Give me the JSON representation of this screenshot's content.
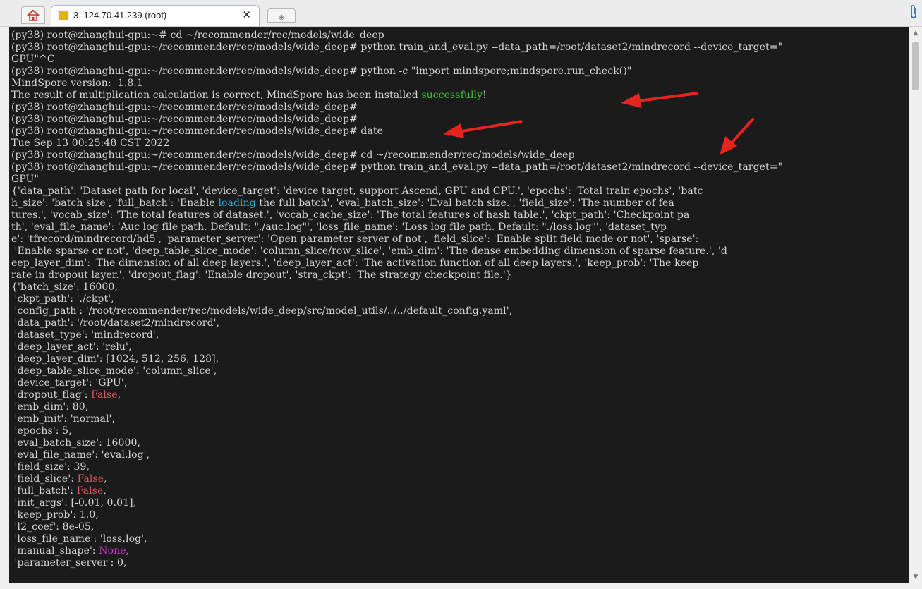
{
  "tab": {
    "title": "3. 124.70.41.239 (root)",
    "close_label": "✕"
  },
  "new_tab_label": "◈",
  "icons": {
    "home": "home-icon",
    "session": "terminal-session-icon",
    "attach": "paperclip-icon"
  },
  "colors": {
    "terminal_bg": "#1b1b1b",
    "terminal_fg": "#d6d6d6",
    "success_green": "#3cc13c",
    "keyword_cyan": "#31a8d6",
    "false_red": "#e2545f",
    "none_magenta": "#c83cc8",
    "arrow_red": "#e8231f"
  },
  "terminal": {
    "lines": [
      [
        {
          "t": "(py38) root@zhanghui-gpu:~# cd ~/recommender/rec/models/wide_deep"
        }
      ],
      [
        {
          "t": "(py38) root@zhanghui-gpu:~/recommender/rec/models/wide_deep# python train_and_eval.py --data_path=/root/dataset2/mindrecord --device_target=\""
        }
      ],
      [
        {
          "t": "GPU\"^C"
        }
      ],
      [
        {
          "t": "(py38) root@zhanghui-gpu:~/recommender/rec/models/wide_deep# python -c \"import mindspore;mindspore.run_check()\""
        }
      ],
      [
        {
          "t": "MindSpore version:  1.8.1"
        }
      ],
      [
        {
          "t": "The result of multiplication calculation is correct, MindSpore has been installed "
        },
        {
          "t": "successfully",
          "c": "green"
        },
        {
          "t": "!"
        }
      ],
      [
        {
          "t": "(py38) root@zhanghui-gpu:~/recommender/rec/models/wide_deep#"
        }
      ],
      [
        {
          "t": "(py38) root@zhanghui-gpu:~/recommender/rec/models/wide_deep#"
        }
      ],
      [
        {
          "t": "(py38) root@zhanghui-gpu:~/recommender/rec/models/wide_deep# date"
        }
      ],
      [
        {
          "t": "Tue Sep 13 00:25:48 CST 2022"
        }
      ],
      [
        {
          "t": "(py38) root@zhanghui-gpu:~/recommender/rec/models/wide_deep# cd ~/recommender/rec/models/wide_deep"
        }
      ],
      [
        {
          "t": "(py38) root@zhanghui-gpu:~/recommender/rec/models/wide_deep# python train_and_eval.py --data_path=/root/dataset2/mindrecord --device_target=\""
        }
      ],
      [
        {
          "t": "GPU\""
        }
      ],
      [
        {
          "t": "{'data_path': 'Dataset path for local', 'device_target': 'device target, support Ascend, GPU and CPU.', 'epochs': 'Total train epochs', 'batc"
        }
      ],
      [
        {
          "t": "h_size': 'batch size', 'full_batch': 'Enable "
        },
        {
          "t": "loading",
          "c": "cyan"
        },
        {
          "t": " the full batch', 'eval_batch_size': 'Eval batch size.', 'field_size': 'The number of fea"
        }
      ],
      [
        {
          "t": "tures.', 'vocab_size': 'The total features of dataset.', 'vocab_cache_size': 'The total features of hash table.', 'ckpt_path': 'Checkpoint pa"
        }
      ],
      [
        {
          "t": "th', 'eval_file_name': 'Auc log file path. Default: \"./auc.log\"', 'loss_file_name': 'Loss log file path. Default: \"./loss.log\"', 'dataset_typ"
        }
      ],
      [
        {
          "t": "e': 'tfrecord/mindrecord/hd5', 'parameter_server': 'Open parameter server of not', 'field_slice': 'Enable split field mode or not', 'sparse':"
        }
      ],
      [
        {
          "t": " 'Enable sparse or not', 'deep_table_slice_mode': 'column_slice/row_slice', 'emb_dim': 'The dense embedding dimension of sparse feature.', 'd"
        }
      ],
      [
        {
          "t": "eep_layer_dim': 'The dimension of all deep layers.', 'deep_layer_act': 'The activation function of all deep layers.', 'keep_prob': 'The keep"
        }
      ],
      [
        {
          "t": "rate in dropout layer.', 'dropout_flag': 'Enable dropout', 'stra_ckpt': 'The strategy checkpoint file.'}"
        }
      ],
      [
        {
          "t": "{'batch_size': 16000,"
        }
      ],
      [
        {
          "t": " 'ckpt_path': './ckpt',"
        }
      ],
      [
        {
          "t": " 'config_path': '/root/recommender/rec/models/wide_deep/src/model_utils/../../default_config.yaml',"
        }
      ],
      [
        {
          "t": " 'data_path': '/root/dataset2/mindrecord',"
        }
      ],
      [
        {
          "t": " 'dataset_type': 'mindrecord',"
        }
      ],
      [
        {
          "t": " 'deep_layer_act': 'relu',"
        }
      ],
      [
        {
          "t": " 'deep_layer_dim': [1024, 512, 256, 128],"
        }
      ],
      [
        {
          "t": " 'deep_table_slice_mode': 'column_slice',"
        }
      ],
      [
        {
          "t": " 'device_target': 'GPU',"
        }
      ],
      [
        {
          "t": " 'dropout_flag': "
        },
        {
          "t": "False",
          "c": "red"
        },
        {
          "t": ","
        }
      ],
      [
        {
          "t": " 'emb_dim': 80,"
        }
      ],
      [
        {
          "t": " 'emb_init': 'normal',"
        }
      ],
      [
        {
          "t": " 'epochs': 5,"
        }
      ],
      [
        {
          "t": " 'eval_batch_size': 16000,"
        }
      ],
      [
        {
          "t": " 'eval_file_name': 'eval.log',"
        }
      ],
      [
        {
          "t": " 'field_size': 39,"
        }
      ],
      [
        {
          "t": " 'field_slice': "
        },
        {
          "t": "False",
          "c": "red"
        },
        {
          "t": ","
        }
      ],
      [
        {
          "t": " 'full_batch': "
        },
        {
          "t": "False",
          "c": "red"
        },
        {
          "t": ","
        }
      ],
      [
        {
          "t": " 'init_args': [-0.01, 0.01],"
        }
      ],
      [
        {
          "t": " 'keep_prob': 1.0,"
        }
      ],
      [
        {
          "t": " 'l2_coef': 8e-05,"
        }
      ],
      [
        {
          "t": " 'loss_file_name': 'loss.log',"
        }
      ],
      [
        {
          "t": " 'manual_shape': "
        },
        {
          "t": "None",
          "c": "magenta"
        },
        {
          "t": ","
        }
      ],
      [
        {
          "t": " 'parameter_server': 0,"
        }
      ]
    ]
  }
}
